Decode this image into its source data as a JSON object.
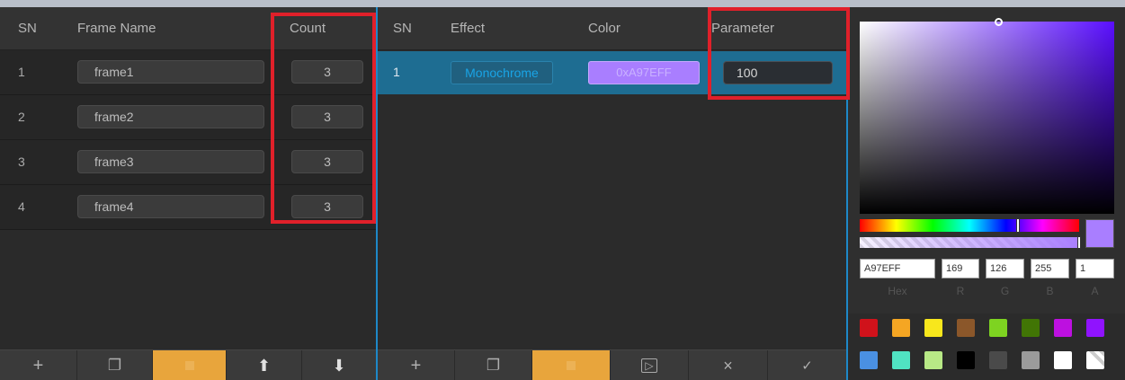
{
  "frames_panel": {
    "headers": {
      "sn": "SN",
      "frame_name": "Frame Name",
      "count": "Count"
    },
    "rows": [
      {
        "sn": "1",
        "name": "frame1",
        "count": "3"
      },
      {
        "sn": "2",
        "name": "frame2",
        "count": "3"
      },
      {
        "sn": "3",
        "name": "frame3",
        "count": "3"
      },
      {
        "sn": "4",
        "name": "frame4",
        "count": "3"
      }
    ],
    "toolbar": {
      "add": "+",
      "copy": "❐",
      "delete": "",
      "up": "⬆",
      "down": "⬇"
    }
  },
  "effects_panel": {
    "headers": {
      "sn": "SN",
      "effect": "Effect",
      "color": "Color",
      "parameter": "Parameter"
    },
    "rows": [
      {
        "sn": "1",
        "effect": "Monochrome",
        "color": "0xA97EFF",
        "parameter": "100"
      }
    ],
    "toolbar": {
      "add": "+",
      "copy": "❐",
      "delete": "",
      "preview": "▷",
      "close": "×",
      "confirm": "✓"
    }
  },
  "color_picker": {
    "hex": "A97EFF",
    "r": "169",
    "g": "126",
    "b": "255",
    "a": "1",
    "labels": {
      "hex": "Hex",
      "r": "R",
      "g": "G",
      "b": "B",
      "a": "A"
    },
    "current_color": "#A97EFF",
    "preset_swatches_row1": [
      "#d0121b",
      "#f5a623",
      "#f8e71c",
      "#8b572a",
      "#7ed321",
      "#417505",
      "#bd10e0",
      "#9013fe"
    ],
    "preset_swatches_row2": [
      "#4a90e2",
      "#50e3c2",
      "#b8e986",
      "#000000",
      "#4a4a4a",
      "#9b9b9b",
      "#ffffff",
      "transparent"
    ]
  },
  "annotation_color": "#e0202a"
}
